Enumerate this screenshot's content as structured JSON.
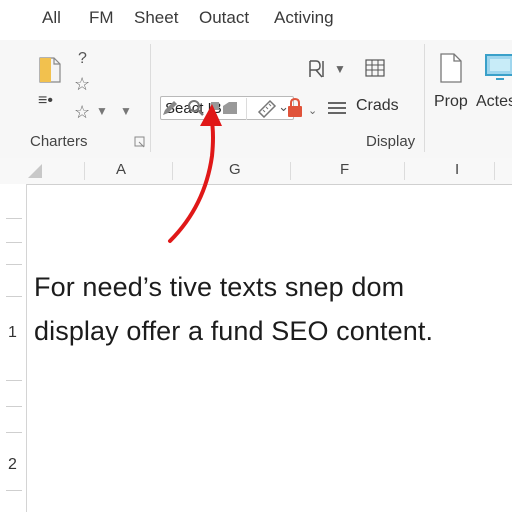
{
  "menu": {
    "tabs": [
      "All",
      "FM",
      "Sheet",
      "Outact",
      "Activing"
    ]
  },
  "ribbon": {
    "group1": {
      "label": "Charters",
      "icons": [
        "document-icon",
        "question-icon",
        "star-icon",
        "list-icon",
        "star-outline-icon",
        "dropdown-icon"
      ]
    },
    "font_box": {
      "value": "Seact IB"
    },
    "crads_label": "Crads",
    "display_label": "Display",
    "prop_label": "Prop",
    "actes_label": "Actes",
    "colors": {
      "lock": "#e0533a",
      "accent_teal": "#3aa0c9",
      "doc_yellow": "#f2c14e"
    }
  },
  "sheet": {
    "columns": [
      "A",
      "G",
      "F",
      "I"
    ],
    "rows": [
      "1",
      "2"
    ],
    "text_lines": [
      "For need’s tive texts snep dom",
      "display offer a fund SEO content."
    ]
  },
  "annotation": {
    "arrow_color": "#e01818"
  }
}
